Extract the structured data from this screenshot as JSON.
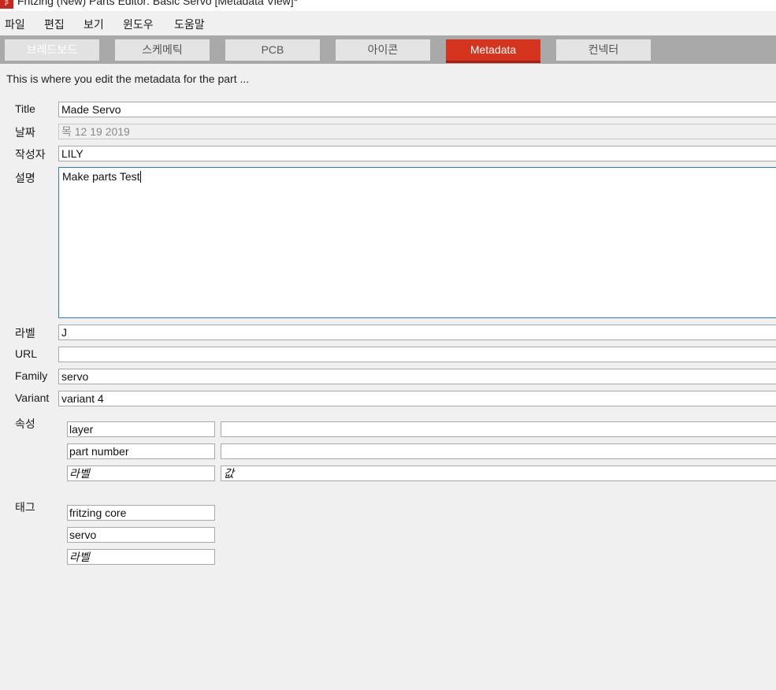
{
  "window": {
    "title": "Fritzing (New) Parts Editor: Basic Servo [Metadata View]*",
    "icon": "fritzing-app-icon"
  },
  "menubar": [
    "파일",
    "편집",
    "보기",
    "윈도우",
    "도움말"
  ],
  "tabs": [
    {
      "label": "브레드보드",
      "state": "disabled"
    },
    {
      "label": "스케메틱",
      "state": "normal"
    },
    {
      "label": "PCB",
      "state": "normal"
    },
    {
      "label": "아이콘",
      "state": "normal"
    },
    {
      "label": "Metadata",
      "state": "active"
    },
    {
      "label": "컨넥터",
      "state": "normal"
    }
  ],
  "colors": {
    "accent": "#d5341f",
    "tabbar": "#a9a9a9",
    "focus_border": "#2f7bc4"
  },
  "hint": "This is where you edit the metadata for the part ...",
  "fields": {
    "title": {
      "label": "Title",
      "value": "Made Servo"
    },
    "date": {
      "label": "날짜",
      "value": "목 12 19 2019"
    },
    "author": {
      "label": "작성자",
      "value": "LILY"
    },
    "description": {
      "label": "설명",
      "value": "Make parts Test"
    },
    "label": {
      "label": "라벨",
      "value": "J"
    },
    "url": {
      "label": "URL",
      "value": ""
    },
    "family": {
      "label": "Family",
      "value": "servo"
    },
    "variant": {
      "label": "Variant",
      "value": "variant 4"
    }
  },
  "properties": {
    "label": "속성",
    "rows": [
      {
        "name": "layer",
        "value": ""
      },
      {
        "name": "part number",
        "value": ""
      }
    ],
    "new_name_placeholder": "라벨",
    "new_value_placeholder": "값"
  },
  "tags": {
    "label": "태그",
    "items": [
      "fritzing core",
      "servo"
    ],
    "new_placeholder": "라벨"
  }
}
